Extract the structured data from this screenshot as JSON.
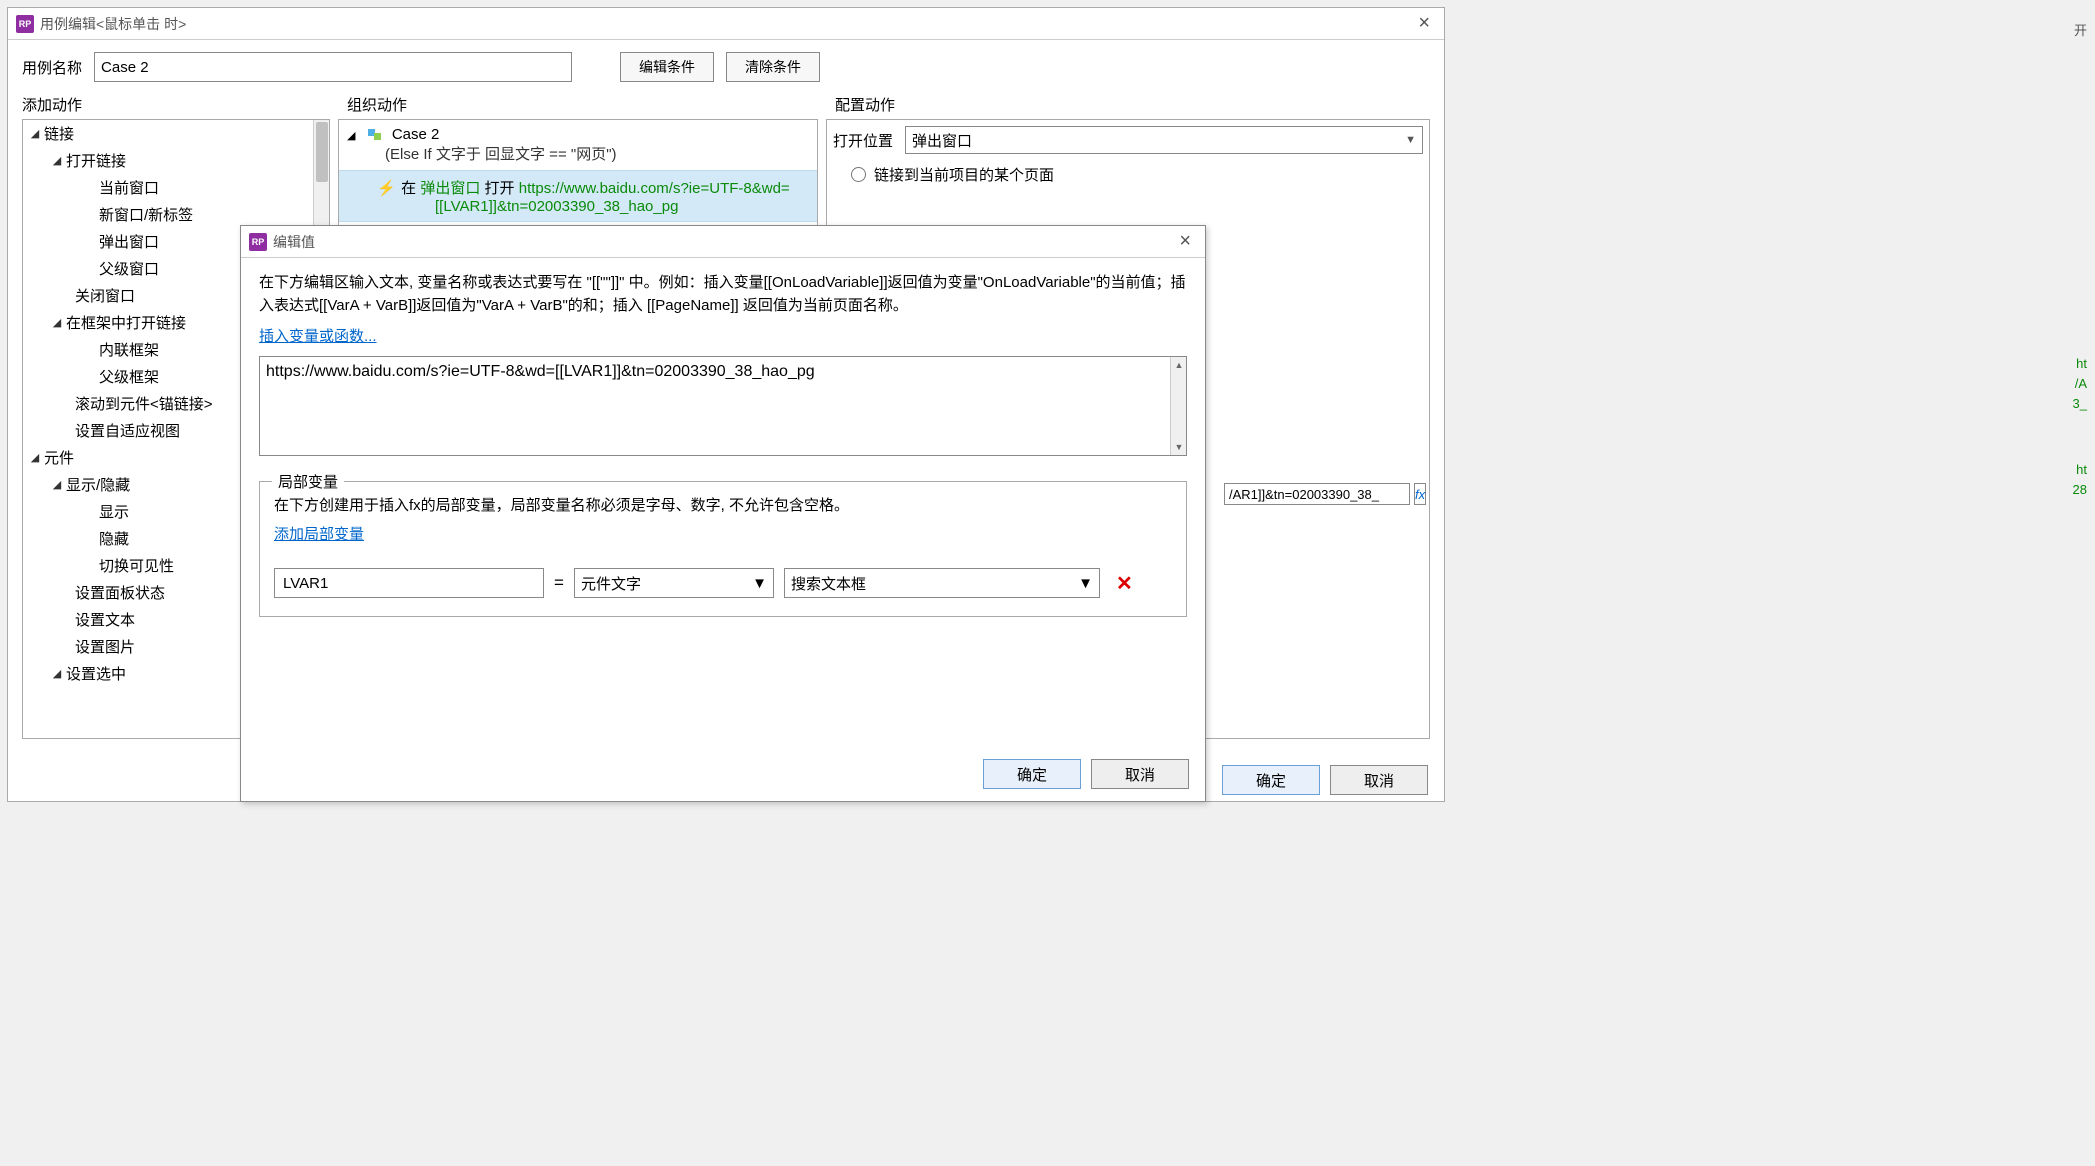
{
  "main": {
    "title": "用例编辑<鼠标单击 时>",
    "name_label": "用例名称",
    "case_name": "Case 2",
    "btn_edit_conditions": "编辑条件",
    "btn_clear_conditions": "清除条件"
  },
  "columns": {
    "add_action": "添加动作",
    "organize": "组织动作",
    "configure": "配置动作"
  },
  "tree": {
    "links": "链接",
    "open_link": "打开链接",
    "current_window": "当前窗口",
    "new_window_tab": "新窗口/新标签",
    "popup": "弹出窗口",
    "parent_window": "父级窗口",
    "close_window": "关闭窗口",
    "open_in_frame": "在框架中打开链接",
    "inline_frame": "内联框架",
    "parent_frame": "父级框架",
    "scroll_to_widget": "滚动到元件<锚链接>",
    "set_adaptive_view": "设置自适应视图",
    "widgets": "元件",
    "show_hide": "显示/隐藏",
    "show": "显示",
    "hide": "隐藏",
    "toggle_visibility": "切换可见性",
    "set_panel_state": "设置面板状态",
    "set_text": "设置文本",
    "set_image": "设置图片",
    "set_selected": "设置选中"
  },
  "organize": {
    "case_label": "Case 2",
    "condition": "(Else If 文字于 回显文字 == \"网页\")",
    "action_prefix": "在",
    "action_popup": "弹出窗口",
    "action_open": "打开",
    "action_url_line1": "https://www.baidu.com/s?ie=UTF-8&wd=",
    "action_url_line2": "[[LVAR1]]&tn=02003390_38_hao_pg"
  },
  "config": {
    "open_in_label": "打开位置",
    "open_in_value": "弹出窗口",
    "radio_link_to_page": "链接到当前项目的某个页面",
    "value_fragment": "/AR1]]&tn=02003390_38_",
    "fx": "fx",
    "ok": "确定",
    "cancel": "取消"
  },
  "modal": {
    "title": "编辑值",
    "instructions": "在下方编辑区输入文本, 变量名称或表达式要写在 \"[[\"\"]]\" 中。例如：插入变量[[OnLoadVariable]]返回值为变量\"OnLoadVariable\"的当前值；插入表达式[[VarA + VarB]]返回值为\"VarA + VarB\"的和；插入 [[PageName]] 返回值为当前页面名称。",
    "insert_link": "插入变量或函数...",
    "text_value": "https://www.baidu.com/s?ie=UTF-8&wd=[[LVAR1]]&tn=02003390_38_hao_pg",
    "local_vars_legend": "局部变量",
    "local_vars_help": "在下方创建用于插入fx的局部变量，局部变量名称必须是字母、数字, 不允许包含空格。",
    "add_local_var": "添加局部变量",
    "var1_name": "LVAR1",
    "var1_eq": "=",
    "var1_type": "元件文字",
    "var1_target": "搜索文本框",
    "ok": "确定",
    "cancel": "取消"
  },
  "side": {
    "t1": "开",
    "t2": "ht",
    "t3": "/A",
    "t4": "3_",
    "t5": "ht",
    "t6": "28"
  }
}
